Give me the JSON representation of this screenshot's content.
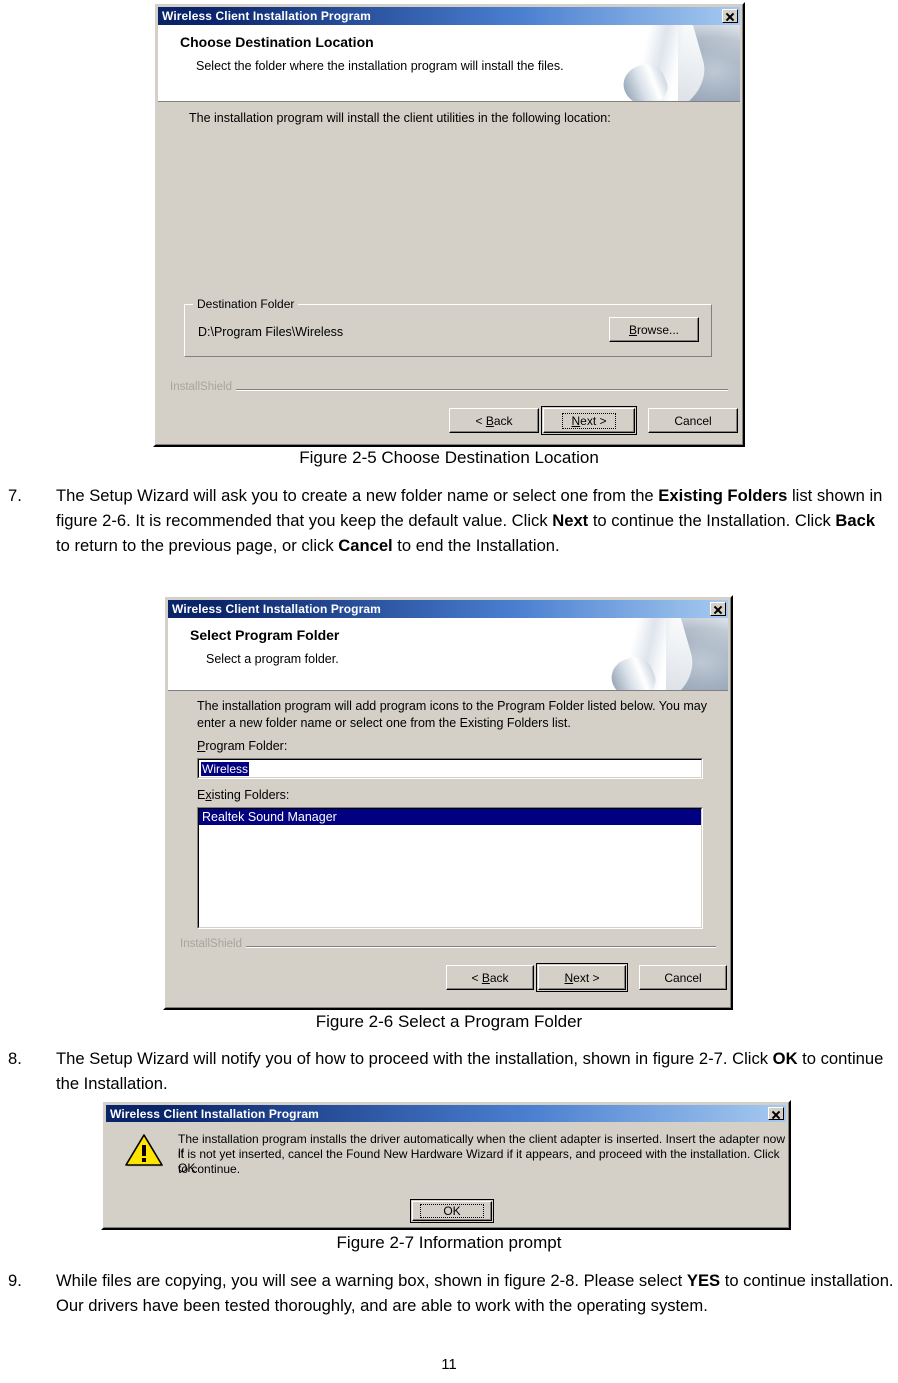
{
  "document": {
    "page_number": "11"
  },
  "dialog1": {
    "name": "choose-destination-location",
    "titlebar": {
      "title": "Wireless Client Installation Program",
      "close_label": "x"
    },
    "header": {
      "heading": "Choose Destination Location",
      "subheading": "Select the folder where the installation program will install the files."
    },
    "body_text": "The installation program will install the client utilities in the following location:",
    "group": {
      "label": "Destination Folder",
      "path": "D:\\Program Files\\Wireless",
      "browse_button": "Browse..."
    },
    "brand": "InstallShield",
    "buttons": {
      "back": "< Back",
      "next": "Next >",
      "cancel": "Cancel"
    }
  },
  "figure1": {
    "caption": "Figure 2-5    Choose Destination Location"
  },
  "step7": {
    "number": "7.",
    "segments": [
      {
        "text": "The Setup Wizard will ask you to create a new folder name or select one from the ",
        "bold": false
      },
      {
        "text": "Existing Folders",
        "bold": true
      },
      {
        "text": " list shown in figure 2-6. It is recommended that you keep the default value. Click ",
        "bold": false
      },
      {
        "text": "Next",
        "bold": true
      },
      {
        "text": " to continue the Installation. Click ",
        "bold": false
      },
      {
        "text": "Back",
        "bold": true
      },
      {
        "text": " to return to the previous page, or click ",
        "bold": false
      },
      {
        "text": "Cancel",
        "bold": true
      },
      {
        "text": " to end the Installation.",
        "bold": false
      }
    ]
  },
  "dialog2": {
    "name": "select-program-folder",
    "titlebar": {
      "title": "Wireless Client Installation Program",
      "close_label": "x"
    },
    "header": {
      "heading": "Select Program Folder",
      "subheading": "Select a program folder."
    },
    "body_text_line1": "The installation program will add program icons to the Program Folder listed below. You may",
    "body_text_line2": "enter a new folder name or select one from the Existing Folders list.",
    "program_folder_label": "Program Folder:",
    "program_folder_value": "Wireless",
    "existing_folders_label": "Existing Folders:",
    "existing_folders_items": [
      "Realtek Sound Manager"
    ],
    "brand": "InstallShield",
    "buttons": {
      "back": "< Back",
      "next": "Next >",
      "cancel": "Cancel"
    }
  },
  "figure2": {
    "caption": "Figure 2-6 Select a Program Folder"
  },
  "step8": {
    "number": "8.",
    "segments": [
      {
        "text": "The Setup Wizard will notify you of how to proceed with the installation, shown in figure 2-7. Click ",
        "bold": false
      },
      {
        "text": "OK",
        "bold": true
      },
      {
        "text": " to continue the Installation.",
        "bold": false
      }
    ]
  },
  "dialog3": {
    "name": "information-prompt",
    "titlebar": {
      "title": "Wireless Client Installation Program",
      "close_label": "x"
    },
    "icon": "warning-triangle-icon",
    "message_line1": "The installation program installs the driver automatically when the client adapter is inserted. Insert the adapter now if",
    "message_line2": "it is not yet inserted, cancel the Found New Hardware Wizard if it appears, and proceed with the installation. Click OK",
    "message_line3": "to continue.",
    "ok_button": "OK"
  },
  "figure3": {
    "caption": "Figure 2-7    Information prompt"
  },
  "step9": {
    "number": "9.",
    "segments": [
      {
        "text": "While files are copying, you will see a warning box, shown in figure 2-8. Please select ",
        "bold": false
      },
      {
        "text": "YES",
        "bold": true
      },
      {
        "text": " to continue installation. Our drivers have been tested thoroughly, and are able to work with the operating system.",
        "bold": false
      }
    ]
  },
  "colors": {
    "dialog_face": "#d4d0c8",
    "titlebar_start": "#0a246a",
    "titlebar_end": "#a6caf0",
    "selection": "#000080",
    "warning_yellow": "#ffe400"
  }
}
